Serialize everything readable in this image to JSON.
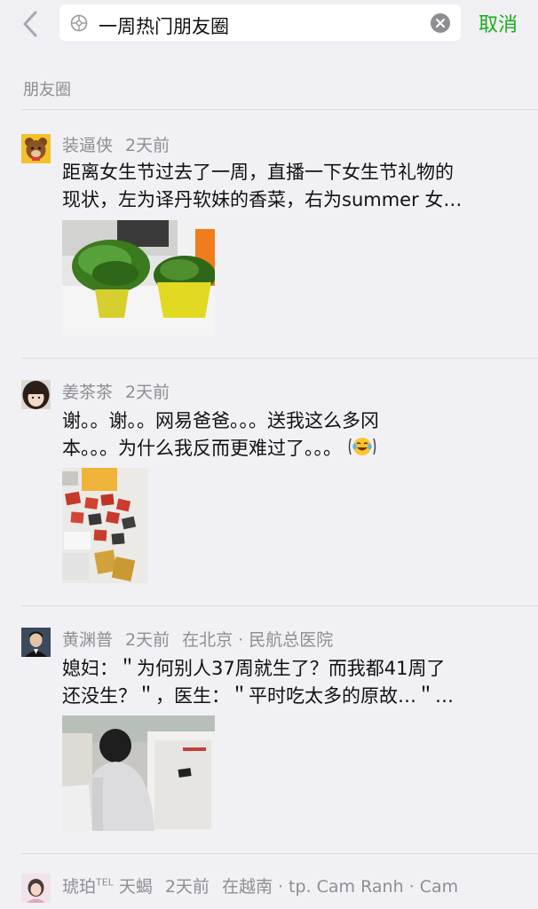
{
  "header": {
    "query": "一周热门朋友圈",
    "cancel_label": "取消"
  },
  "section": {
    "title": "朋友圈"
  },
  "posts": [
    {
      "author": "装逼侠",
      "time": "2天前",
      "location": "",
      "lines": [
        "距离女生节过去了一周，直播一下女生节礼物的",
        "现状，左为译丹软妹的香菜，右为summer 女…"
      ]
    },
    {
      "author": "姜茶茶",
      "time": "2天前",
      "location": "",
      "lines": [
        "谢。。谢。。网易爸爸。。。送我这么多冈",
        "本。。。为什么我反而更难过了。。。"
      ]
    },
    {
      "author": "黄渊普",
      "time": "2天前",
      "location": "在北京 · 民航总医院",
      "lines": [
        "媳妇：＂为何别人37周就生了？而我都41周了",
        "还没生？＂，医生：＂平时吃太多的原故…＂…"
      ]
    },
    {
      "author": "琥珀",
      "author_suffix": "TEL",
      "author_extra": "天蝎",
      "time": "2天前",
      "location": "在越南 · tp. Cam Ranh · Cam",
      "lines": []
    }
  ],
  "icons": {
    "back": "chevron-left-icon",
    "tag": "moments-tag-icon",
    "clear": "clear-icon"
  },
  "colors": {
    "accent": "#1aad19",
    "background": "#f1f0f5"
  }
}
